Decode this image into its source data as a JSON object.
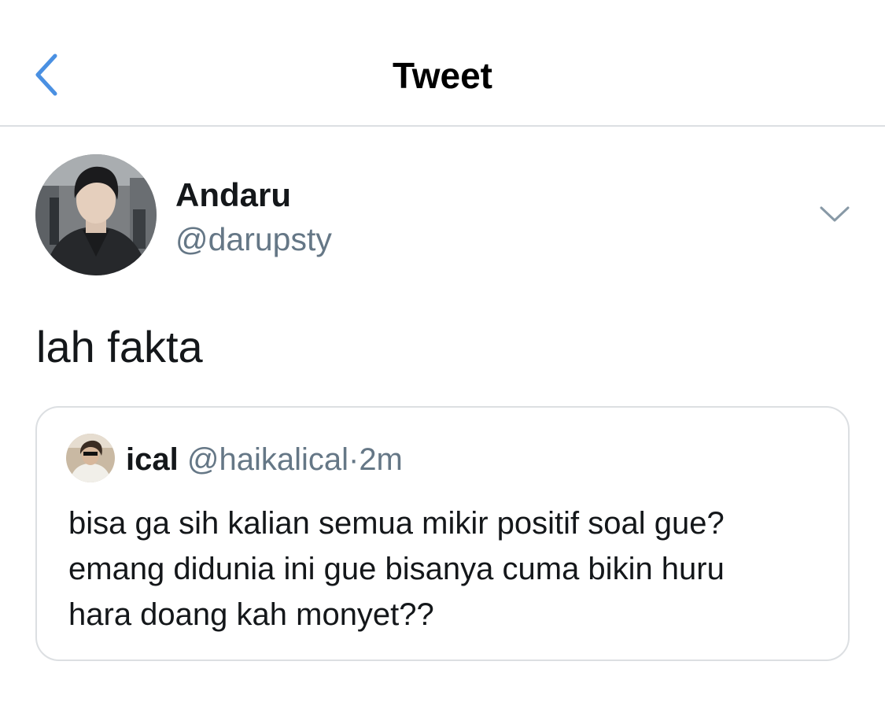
{
  "header": {
    "title": "Tweet",
    "back_icon": "chevron-left-icon",
    "accent_color": "#4a90e2"
  },
  "author": {
    "name": "Andaru",
    "handle": "@darupsty",
    "avatar": "profile-photo",
    "menu_icon": "chevron-down-icon"
  },
  "tweet": {
    "text": "lah fakta"
  },
  "quoted_tweet": {
    "name": "ical",
    "handle": "@haikalical",
    "separator": "·",
    "time": "2m",
    "lines": [
      "bisa ga sih kalian semua mikir positif soal gue?",
      "emang didunia ini gue bisanya cuma bikin huru",
      "hara doang kah monyet??"
    ]
  },
  "colors": {
    "text_primary": "#14171a",
    "text_secondary": "#657786",
    "divider": "#dcdfe2"
  }
}
